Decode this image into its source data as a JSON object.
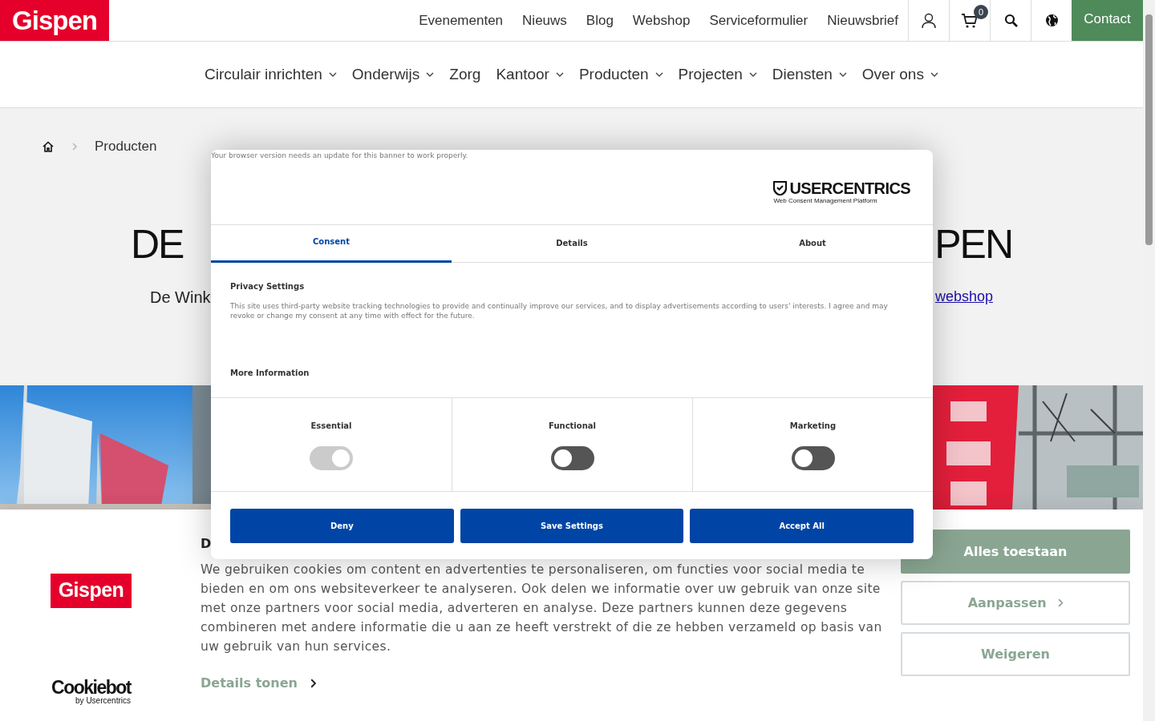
{
  "header": {
    "logo": "Gispen",
    "links": [
      "Evenementen",
      "Nieuws",
      "Blog",
      "Webshop",
      "Serviceformulier",
      "Nieuwsbrief"
    ],
    "cart_count": "0",
    "contact": "Contact"
  },
  "main_nav": [
    {
      "label": "Circulair inrichten",
      "has_menu": true
    },
    {
      "label": "Onderwijs",
      "has_menu": true
    },
    {
      "label": "Zorg",
      "has_menu": false
    },
    {
      "label": "Kantoor",
      "has_menu": true
    },
    {
      "label": "Producten",
      "has_menu": true
    },
    {
      "label": "Projecten",
      "has_menu": true
    },
    {
      "label": "Diensten",
      "has_menu": true
    },
    {
      "label": "Over ons",
      "has_menu": true
    }
  ],
  "breadcrumb": [
    "Producten"
  ],
  "hero": {
    "title_left": "DE",
    "title_right": "PEN",
    "subtitle_left": "De Wink",
    "subtitle_link": "webshop"
  },
  "cookie_banner": {
    "logo": "Gispen",
    "heading": "D",
    "text": "We gebruiken cookies om content en advertenties te personaliseren, om functies voor social media te bieden en om ons websiteverkeer te analyseren. Ook delen we informatie over uw gebruik van onze site met onze partners voor social media, adverteren en analyse. Deze partners kunnen deze gegevens combineren met andere informatie die u aan ze heeft verstrekt of die ze hebben verzameld op basis van uw gebruik van hun services.",
    "details_link": "Details tonen",
    "powered_by": "Cookiebot",
    "powered_sub": "by Usercentrics",
    "buttons": [
      {
        "label": "Alles toestaan",
        "kind": "primary"
      },
      {
        "label": "Aanpassen",
        "kind": "more"
      },
      {
        "label": "Weigeren",
        "kind": "outline"
      }
    ]
  },
  "consent_modal": {
    "notice": "Your browser version needs an update for this banner to work properly.",
    "brand": "USERCENTRICS",
    "brand_sub": "Web Consent Management Platform",
    "tabs": [
      {
        "label": "Consent",
        "selected": true
      },
      {
        "label": "Details",
        "selected": false
      },
      {
        "label": "About",
        "selected": false
      }
    ],
    "heading": "Privacy Settings",
    "text": "This site uses third-party website tracking technologies to provide and continually improve our services, and to display advertisements according to users' interests. I agree and may revoke or change my consent at any time with effect for the future.",
    "more": "More Information",
    "categories": [
      {
        "label": "Essential",
        "on": true,
        "disabled": true
      },
      {
        "label": "Functional",
        "on": false,
        "disabled": false
      },
      {
        "label": "Marketing",
        "on": false,
        "disabled": false
      }
    ],
    "buttons": [
      "Deny",
      "Save Settings",
      "Accept All"
    ]
  }
}
